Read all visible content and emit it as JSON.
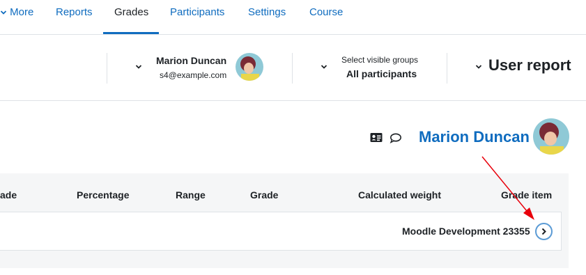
{
  "nav": {
    "items": [
      {
        "label": "More"
      },
      {
        "label": "Reports"
      },
      {
        "label": "Grades"
      },
      {
        "label": "Participants"
      },
      {
        "label": "Settings"
      },
      {
        "label": "Course"
      }
    ],
    "active": "Grades"
  },
  "user_selector": {
    "name": "Marion Duncan",
    "email": "s4@example.com"
  },
  "groups_selector": {
    "label": "Select visible groups",
    "value": "All participants"
  },
  "report_selector": {
    "title": "User report"
  },
  "user_heading": {
    "name": "Marion Duncan",
    "icons": [
      "contact-card-icon",
      "message-icon"
    ]
  },
  "table": {
    "columns": [
      "ade",
      "Percentage",
      "Range",
      "Grade",
      "Calculated weight",
      "Grade item"
    ],
    "rows": [
      {
        "item": "Moodle Development 23355"
      }
    ]
  },
  "colors": {
    "link": "#0f6cbf",
    "annotation_arrow": "#e8000b",
    "expand_ring": "#5b9bd5"
  }
}
